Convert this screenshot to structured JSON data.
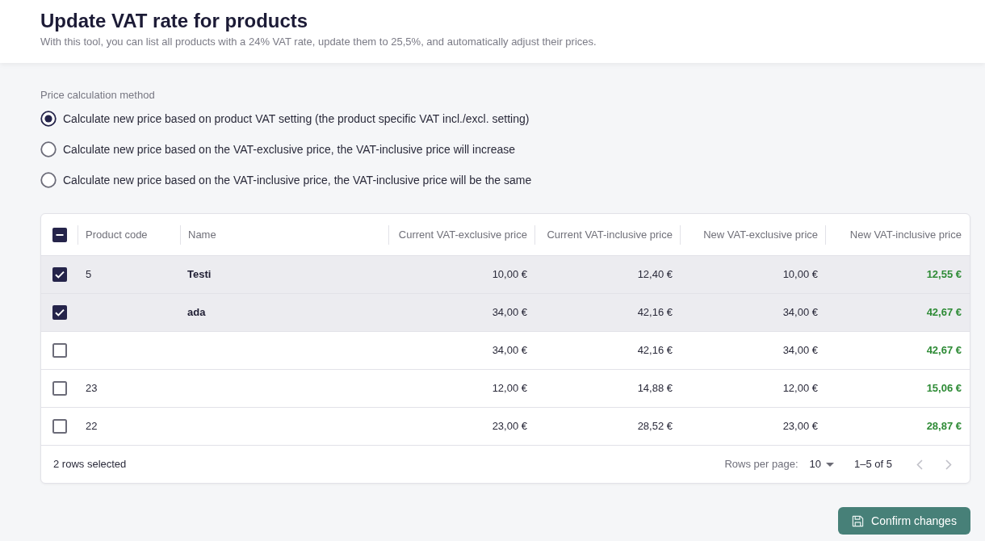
{
  "header": {
    "title": "Update VAT rate for products",
    "subtitle": "With this tool, you can list all products with a 24% VAT rate, update them to 25,5%, and automatically adjust their prices."
  },
  "price_method": {
    "label": "Price calculation method",
    "options": [
      {
        "label": "Calculate new price based on product VAT setting (the product specific VAT incl./excl. setting)",
        "selected": true
      },
      {
        "label": "Calculate new price based on the VAT-exclusive price, the VAT-inclusive price will increase",
        "selected": false
      },
      {
        "label": "Calculate new price based on the VAT-inclusive price, the VAT-inclusive price will be the same",
        "selected": false
      }
    ]
  },
  "table": {
    "select_all": {
      "indeterminate": true
    },
    "columns": [
      "Product code",
      "Name",
      "Current VAT-exclusive price",
      "Current VAT-inclusive price",
      "New VAT-exclusive price",
      "New VAT-inclusive price"
    ],
    "rows": [
      {
        "selected": true,
        "product_code": "5",
        "name": "Testi",
        "current_excl": "10,00 €",
        "current_incl": "12,40 €",
        "new_excl": "10,00 €",
        "new_incl": "12,55 €"
      },
      {
        "selected": true,
        "name": "ada",
        "current_excl": "34,00 €",
        "current_incl": "42,16 €",
        "new_excl": "34,00 €",
        "new_incl": "42,67 €"
      },
      {
        "selected": false,
        "current_excl": "34,00 €",
        "current_incl": "42,16 €",
        "new_excl": "34,00 €",
        "new_incl": "42,67 €"
      },
      {
        "selected": false,
        "product_code": "23",
        "current_excl": "12,00 €",
        "current_incl": "14,88 €",
        "new_excl": "12,00 €",
        "new_incl": "15,06 €"
      },
      {
        "selected": false,
        "product_code": "22",
        "current_excl": "23,00 €",
        "current_incl": "28,52 €",
        "new_excl": "23,00 €",
        "new_incl": "28,87 €"
      }
    ],
    "footer": {
      "selection_count": "2 rows selected",
      "rows_per_page_label": "Rows per page:",
      "rows_per_page": "10",
      "range": "1–5 of 5",
      "prev": {
        "disabled": true
      },
      "next": {
        "disabled": true
      }
    }
  },
  "confirm_button": {
    "label": "Confirm changes"
  }
}
